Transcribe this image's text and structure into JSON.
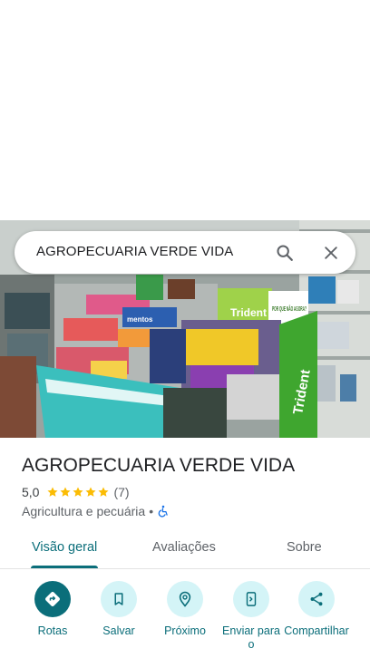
{
  "search": {
    "query": "AGROPECUARIA VERDE VIDA"
  },
  "photo": {
    "signs": {
      "trident_panel": "Trident",
      "question_panel": "POR QUE NÃO AGORA?",
      "mentos": "mentos",
      "trident_vertical": "Trident"
    }
  },
  "place": {
    "name": "AGROPECUARIA VERDE VIDA",
    "rating": "5,0",
    "stars": 5,
    "review_count": "(7)",
    "category": "Agricultura e pecuária",
    "separator": "•",
    "accessibility_icon": "wheelchair-icon"
  },
  "tabs": [
    {
      "label": "Visão geral",
      "active": true
    },
    {
      "label": "Avaliações",
      "active": false
    },
    {
      "label": "Sobre",
      "active": false
    }
  ],
  "actions": [
    {
      "label": "Rotas",
      "icon": "directions-icon"
    },
    {
      "label": "Salvar",
      "icon": "bookmark-icon"
    },
    {
      "label": "Próximo",
      "icon": "nearby-icon"
    },
    {
      "label": "Enviar para o",
      "icon": "send-to-phone-icon"
    },
    {
      "label": "Compartilhar",
      "icon": "share-icon"
    }
  ],
  "colors": {
    "accent": "#0b6e7a",
    "accent_light": "#d4f4f7",
    "star": "#fbbc04",
    "accessibility_blue": "#1a73e8"
  }
}
